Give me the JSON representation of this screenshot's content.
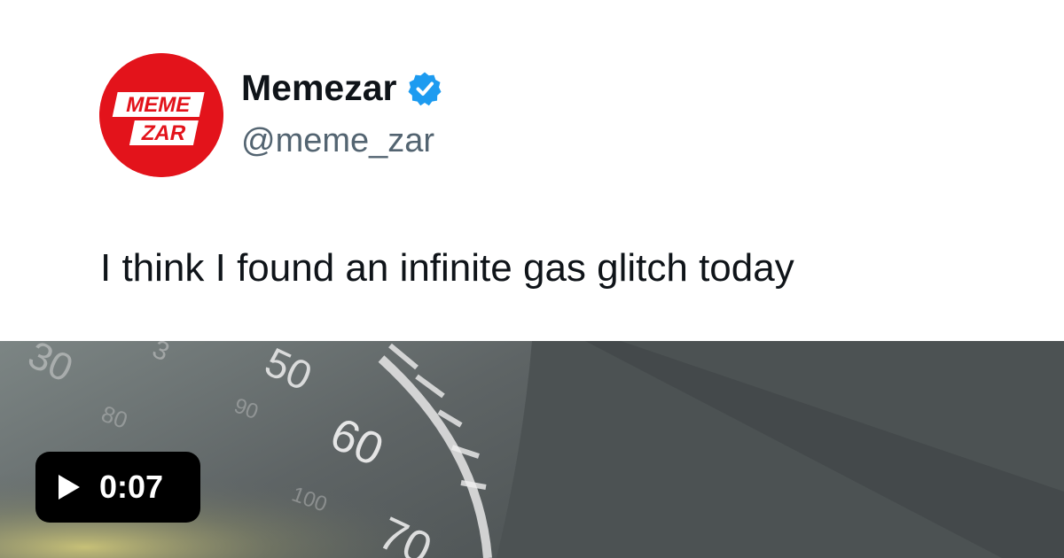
{
  "post": {
    "author": {
      "display_name": "Memezar",
      "handle": "@meme_zar",
      "verified": true,
      "avatar_text_line1": "MEME",
      "avatar_text_line2": "ZAR"
    },
    "text": "I think I found an infinite gas glitch today"
  },
  "media": {
    "kind": "video",
    "duration": "0:07",
    "speedometer_labels": [
      "50",
      "60",
      "70"
    ]
  },
  "colors": {
    "avatar_bg": "#e3131b",
    "verified_badge": "#1d9bf0",
    "text_primary": "#0f1419",
    "text_secondary": "#536471",
    "badge_bg": "#000000"
  },
  "icons": {
    "verified": "verified-badge-icon",
    "play": "play-icon"
  }
}
